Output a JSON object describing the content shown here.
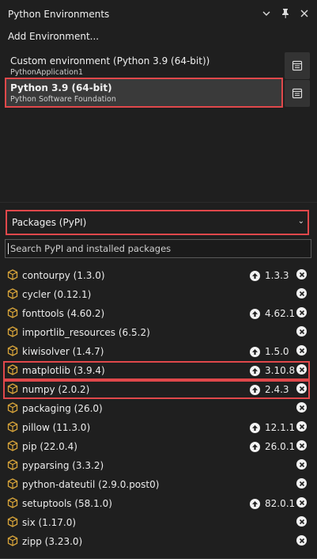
{
  "window": {
    "title": "Python Environments",
    "icons": [
      "chevron-down-icon",
      "pin-icon",
      "close-icon"
    ]
  },
  "add_environment_label": "Add Environment...",
  "environments": [
    {
      "name": "Custom environment (Python 3.9 (64-bit))",
      "subtitle": "PythonApplication1",
      "selected": false
    },
    {
      "name": "Python 3.9 (64-bit)",
      "subtitle": "Python Software Foundation",
      "selected": true
    }
  ],
  "packages_view": {
    "selected": "Packages (PyPI)"
  },
  "search": {
    "placeholder": "Search PyPI and installed packages",
    "value": ""
  },
  "packages": [
    {
      "name": "contourpy (1.3.0)",
      "upgrade": "1.3.3",
      "highlighted": false
    },
    {
      "name": "cycler (0.12.1)",
      "upgrade": "",
      "highlighted": false
    },
    {
      "name": "fonttools (4.60.2)",
      "upgrade": "4.62.1",
      "highlighted": false
    },
    {
      "name": "importlib_resources (6.5.2)",
      "upgrade": "",
      "highlighted": false
    },
    {
      "name": "kiwisolver (1.4.7)",
      "upgrade": "1.5.0",
      "highlighted": false
    },
    {
      "name": "matplotlib (3.9.4)",
      "upgrade": "3.10.8",
      "highlighted": true
    },
    {
      "name": "numpy (2.0.2)",
      "upgrade": "2.4.3",
      "highlighted": true
    },
    {
      "name": "packaging (26.0)",
      "upgrade": "",
      "highlighted": false
    },
    {
      "name": "pillow (11.3.0)",
      "upgrade": "12.1.1",
      "highlighted": false
    },
    {
      "name": "pip (22.0.4)",
      "upgrade": "26.0.1",
      "highlighted": false
    },
    {
      "name": "pyparsing (3.3.2)",
      "upgrade": "",
      "highlighted": false
    },
    {
      "name": "python-dateutil (2.9.0.post0)",
      "upgrade": "",
      "highlighted": false
    },
    {
      "name": "setuptools (58.1.0)",
      "upgrade": "82.0.1",
      "highlighted": false
    },
    {
      "name": "six (1.17.0)",
      "upgrade": "",
      "highlighted": false
    },
    {
      "name": "zipp (3.23.0)",
      "upgrade": "",
      "highlighted": false
    }
  ],
  "colors": {
    "background": "#1f1f1f",
    "highlight_border": "#e0484b",
    "package_icon": "#d9a53a"
  }
}
